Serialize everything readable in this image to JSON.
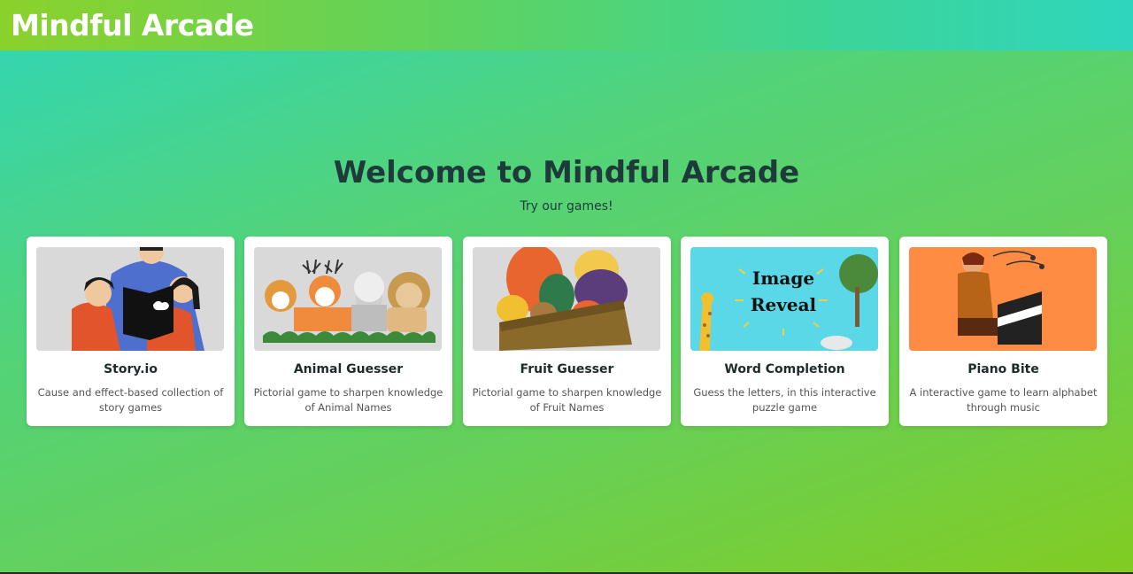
{
  "header": {
    "brand": "Mindful Arcade"
  },
  "hero": {
    "title": "Welcome to Mindful Arcade",
    "subtitle": "Try our games!"
  },
  "games": [
    {
      "title": "Story.io",
      "description": "Cause and effect-based collection of story games",
      "icon": "family-reading-illustration"
    },
    {
      "title": "Animal Guesser",
      "description": "Pictorial game to sharpen knowledge of Animal Names",
      "icon": "animals-illustration"
    },
    {
      "title": "Fruit Guesser",
      "description": "Pictorial game to sharpen knowledge of Fruit Names",
      "icon": "fruit-basket-illustration"
    },
    {
      "title": "Word Completion",
      "description": "Guess the letters, in this interactive puzzle game",
      "icon": "image-reveal-illustration",
      "thumb_text_1": "Image",
      "thumb_text_2": "Reveal"
    },
    {
      "title": "Piano Bite",
      "description": "A interactive game to learn alphabet through music",
      "icon": "piano-player-illustration"
    }
  ],
  "colors": {
    "header_start": "#8bd12b",
    "header_end": "#2fd6bd",
    "title_text": "#1e3a3a",
    "card_bg": "#ffffff"
  }
}
